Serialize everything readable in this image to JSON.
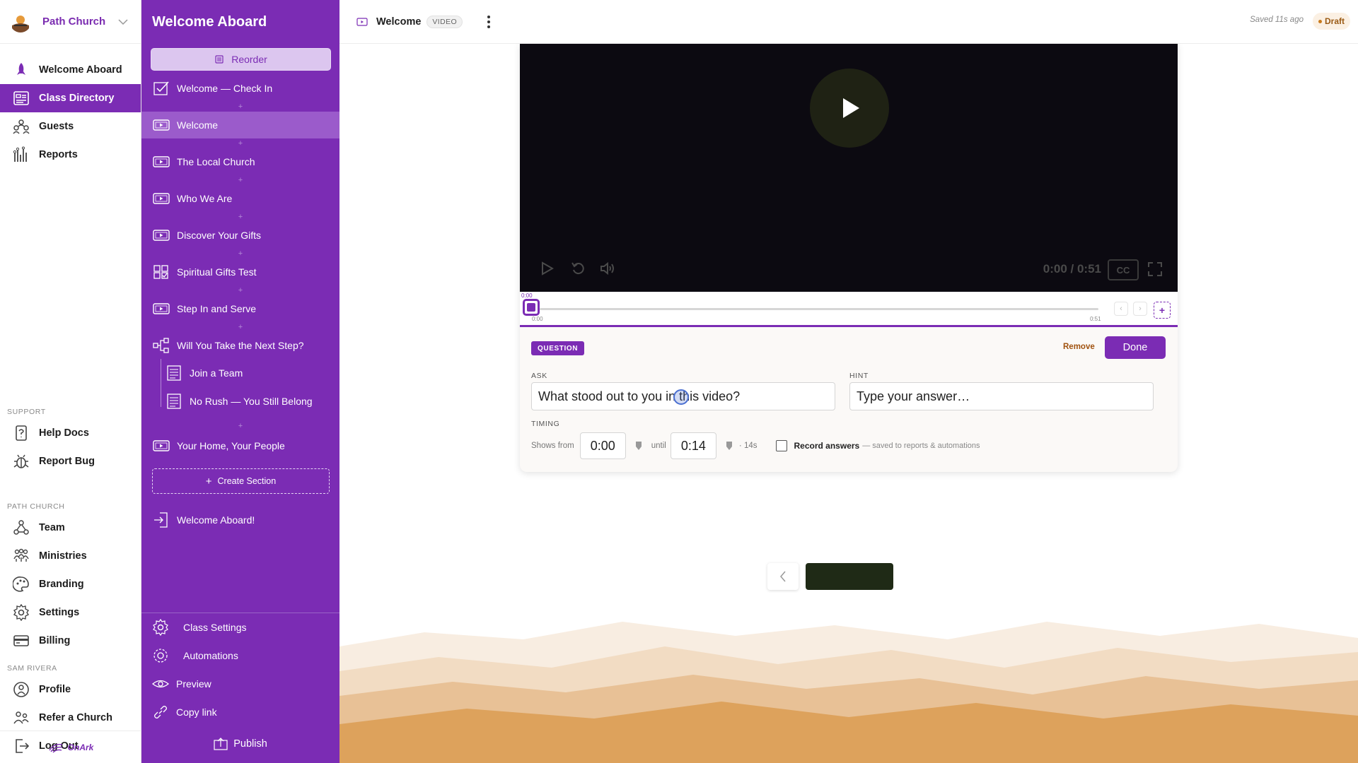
{
  "org": {
    "name": "Path Church"
  },
  "nav": {
    "primary": [
      {
        "label": "Welcome Aboard",
        "icon": "rocket-icon"
      },
      {
        "label": "Class Directory",
        "icon": "directory-icon"
      },
      {
        "label": "Guests",
        "icon": "people-icon"
      },
      {
        "label": "Reports",
        "icon": "reports-icon"
      }
    ],
    "support_label": "SUPPORT",
    "support": [
      {
        "label": "Help Docs",
        "icon": "document-icon"
      },
      {
        "label": "Report Bug",
        "icon": "bug-icon"
      }
    ],
    "church_label": "PATH CHURCH",
    "church": [
      {
        "label": "Team",
        "icon": "team-icon"
      },
      {
        "label": "Ministries",
        "icon": "ministries-icon"
      },
      {
        "label": "Branding",
        "icon": "palette-icon"
      },
      {
        "label": "Settings",
        "icon": "gear-icon"
      },
      {
        "label": "Billing",
        "icon": "card-icon"
      }
    ],
    "user_label": "SAM RIVERA",
    "user": [
      {
        "label": "Profile",
        "icon": "profile-icon"
      },
      {
        "label": "Refer a Church",
        "icon": "refer-icon"
      },
      {
        "label": "Log Out",
        "icon": "logout-icon"
      }
    ],
    "brand": "OnArk"
  },
  "class_panel": {
    "title": "Welcome Aboard",
    "reorder": "Reorder",
    "lessons": [
      {
        "label": "Welcome — Check In",
        "icon": "checkin-icon"
      },
      {
        "label": "Welcome",
        "icon": "video-icon"
      },
      {
        "label": "The Local Church",
        "icon": "video-icon"
      },
      {
        "label": "Who We Are",
        "icon": "video-icon"
      },
      {
        "label": "Discover Your Gifts",
        "icon": "video-icon"
      },
      {
        "label": "Spiritual Gifts Test",
        "icon": "quiz-icon"
      },
      {
        "label": "Step In and Serve",
        "icon": "video-icon"
      },
      {
        "label": "Will You Take the Next Step?",
        "icon": "branch-icon"
      },
      {
        "label": "Join a Team",
        "icon": "form-icon"
      },
      {
        "label": "No Rush — You Still Belong",
        "icon": "form-icon"
      },
      {
        "label": "Your Home, Your People",
        "icon": "video-icon"
      }
    ],
    "create_section": "Create Section",
    "finale": "Welcome Aboard!",
    "bottom": {
      "class_settings": "Class Settings",
      "automations": "Automations",
      "preview": "Preview",
      "copy_link": "Copy link",
      "publish": "Publish"
    }
  },
  "topbar": {
    "title": "Welcome",
    "type": "VIDEO",
    "saved": "Saved 11s ago",
    "status": "Draft"
  },
  "video": {
    "time": "0:00 / 0:51",
    "cc": "CC"
  },
  "timeline": {
    "current": "0:00",
    "start": "0:00",
    "end": "0:51"
  },
  "question": {
    "badge": "QUESTION",
    "remove": "Remove",
    "done": "Done",
    "ask_label": "ASK",
    "ask_value": "What stood out to you in this video?",
    "hint_label": "HINT",
    "hint_placeholder": "Type your answer…",
    "timing_label": "TIMING",
    "shows_from": "Shows from",
    "from_value": "0:00",
    "until": "until",
    "until_value": "0:14",
    "duration": "· 14s",
    "record": "Record answers",
    "record_note": "— saved to reports & automations"
  },
  "colors": {
    "accent": "#7b2cb4",
    "draft": "#9a5a14",
    "remove": "#a0520f"
  }
}
